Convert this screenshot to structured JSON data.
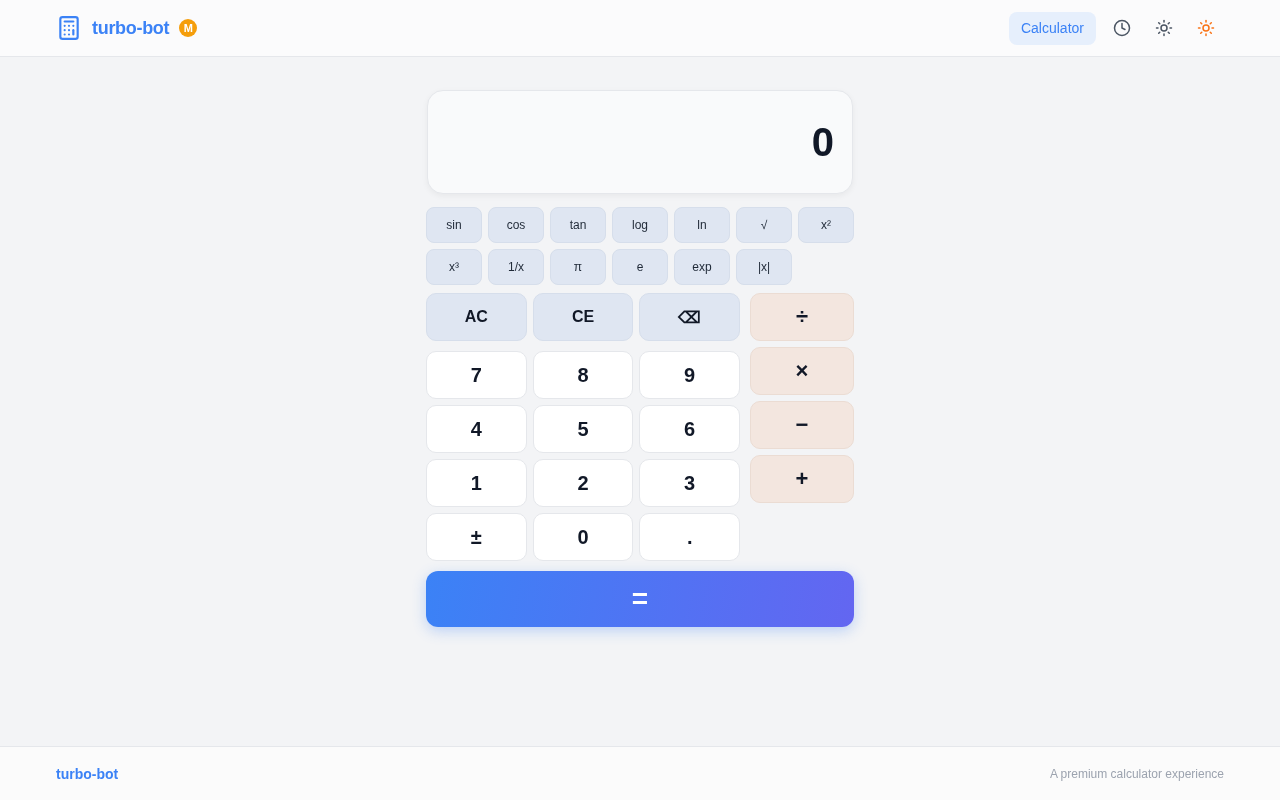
{
  "header": {
    "brand": "turbo-bot",
    "badge": "M",
    "nav": [
      {
        "label": "Calculator",
        "selected": true
      }
    ],
    "actions": [
      {
        "kind": "history",
        "highlighted": false
      },
      {
        "kind": "theme",
        "highlighted": false
      },
      {
        "kind": "theme",
        "highlighted": true
      }
    ]
  },
  "display": {
    "value": "0"
  },
  "scientific_keys": [
    "sin",
    "cos",
    "tan",
    "log",
    "ln",
    "√",
    "x²",
    "x³",
    "1/x",
    "π",
    "e",
    "exp",
    "|x|"
  ],
  "function_keys": [
    "AC",
    "CE",
    "⌫"
  ],
  "digit_keys": [
    "7",
    "8",
    "9",
    "4",
    "5",
    "6",
    "1",
    "2",
    "3",
    "±",
    "0",
    "."
  ],
  "operator_keys": [
    "÷",
    "×",
    "−",
    "+"
  ],
  "equals_key": "=",
  "footer": {
    "brand": "turbo-bot",
    "tagline": "A premium calculator experience"
  }
}
